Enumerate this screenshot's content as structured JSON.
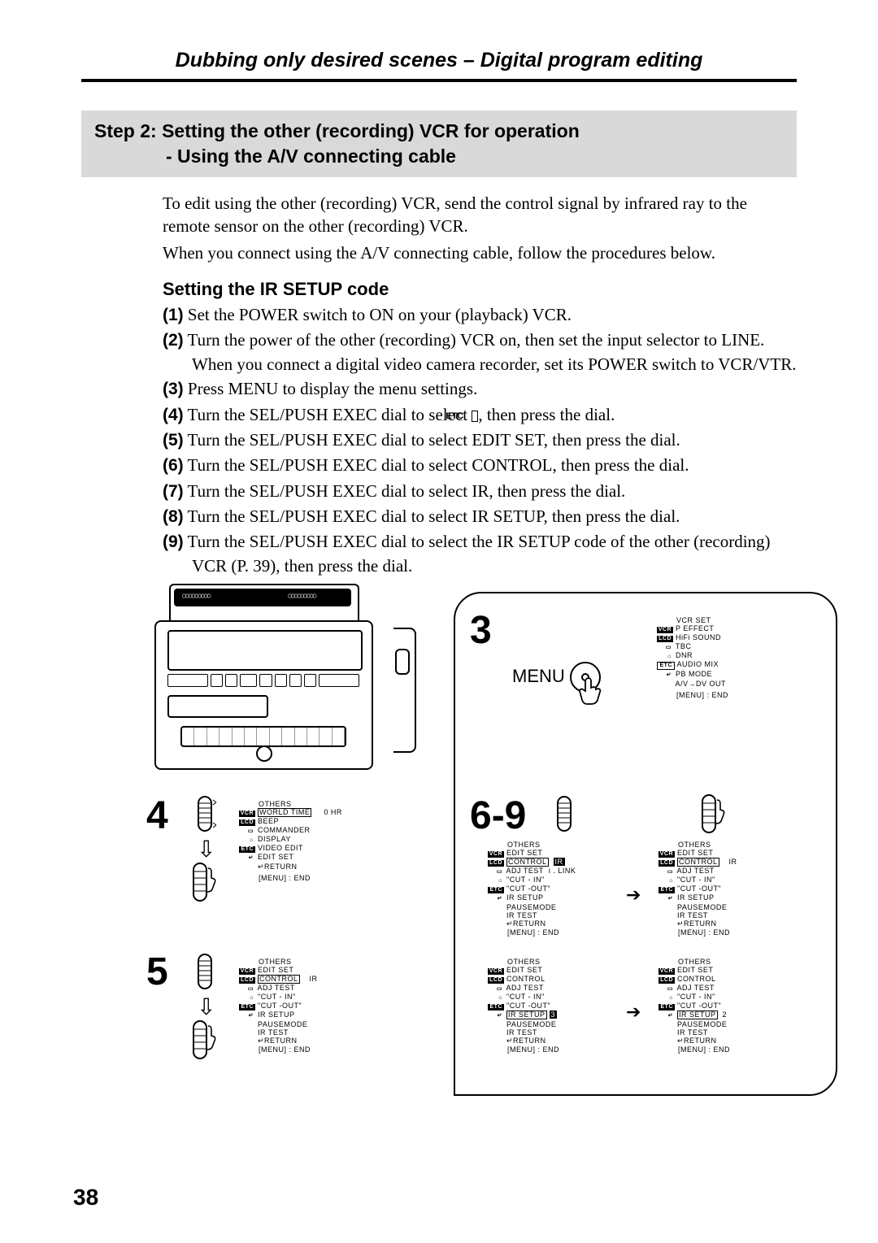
{
  "header": "Dubbing only desired scenes – Digital program editing",
  "step_box_l1": "Step 2: Setting the other (recording) VCR for operation",
  "step_box_l2": "- Using the A/V connecting cable",
  "intro_p1": "To edit using the other (recording) VCR, send the control signal by infrared ray to the remote sensor on the other (recording) VCR.",
  "intro_p2": "When you connect using the A/V connecting cable, follow the procedures below.",
  "sub_head": "Setting the IR SETUP code",
  "steps": {
    "n1": "(1)",
    "t1": "Set the POWER switch to ON on your (playback) VCR.",
    "n2": "(2)",
    "t2a": "Turn the power of the other (recording) VCR on, then set the input selector to LINE.",
    "t2b": "When you connect a digital video camera recorder, set its POWER switch to VCR/VTR.",
    "n3": "(3)",
    "t3": "Press MENU to display the menu settings.",
    "n4": "(4)",
    "t4a": "Turn the SEL/PUSH EXEC dial to select ",
    "t4b": ", then press the dial.",
    "n5": "(5)",
    "t5": "Turn the SEL/PUSH EXEC dial to select EDIT SET, then press the dial.",
    "n6": "(6)",
    "t6": "Turn the SEL/PUSH EXEC dial to select CONTROL, then press the dial.",
    "n7": "(7)",
    "t7": "Turn the SEL/PUSH EXEC dial to select IR, then press the dial.",
    "n8": "(8)",
    "t8": "Turn the SEL/PUSH EXEC dial to select IR SETUP, then press the dial.",
    "n9": "(9)",
    "t9": "Turn the SEL/PUSH EXEC dial to select the IR SETUP code of the other (recording) VCR (P. 39), then press the dial."
  },
  "etc_label": "ETC",
  "fig": {
    "n3": "3",
    "n4": "4",
    "n5": "5",
    "n69": "6-9",
    "menu_label": "MENU",
    "osd3": {
      "title": "VCR SET",
      "rows": [
        "P EFFECT",
        "HiFi SOUND",
        "TBC",
        "DNR",
        "AUDIO MIX",
        "PB MODE",
        "A/V→DV OUT"
      ],
      "foot": "[MENU] : END"
    },
    "osd4": {
      "title": "OTHERS",
      "rows": [
        "WORLD TIME",
        "BEEP",
        "COMMANDER",
        "DISPLAY",
        "VIDEO EDIT",
        "EDIT SET",
        "↵RETURN"
      ],
      "value": "0 HR",
      "foot": "[MENU] : END"
    },
    "osd5": {
      "title": "OTHERS",
      "rows": [
        "EDIT SET",
        "CONTROL",
        "ADJ TEST",
        "\"CUT - IN\"",
        "\"CUT -OUT\"",
        "IR SETUP",
        "PAUSEMODE",
        "IR TEST",
        "↵RETURN"
      ],
      "value": "IR",
      "foot": "[MENU] : END"
    },
    "osd6a": {
      "title": "OTHERS",
      "rows": [
        "EDIT SET",
        "CONTROL",
        "ADJ TEST",
        "\"CUT - IN\"",
        "\"CUT -OUT\"",
        "IR SETUP",
        "PAUSEMODE",
        "IR TEST",
        "↵RETURN"
      ],
      "value": "IR",
      "value2": "i . LINK",
      "foot": "[MENU] : END"
    },
    "osd6b": {
      "title": "OTHERS",
      "rows": [
        "EDIT SET",
        "CONTROL",
        "ADJ TEST",
        "\"CUT - IN\"",
        "\"CUT -OUT\"",
        "IR SETUP",
        "PAUSEMODE",
        "IR TEST",
        "↵RETURN"
      ],
      "value": "IR",
      "foot": "[MENU] : END"
    },
    "osd7a": {
      "title": "OTHERS",
      "rows": [
        "EDIT SET",
        "CONTROL",
        "ADJ TEST",
        "\"CUT - IN\"",
        "\"CUT -OUT\"",
        "IR SETUP",
        "PAUSEMODE",
        "IR TEST",
        "↵RETURN"
      ],
      "value": "3",
      "foot": "[MENU] : END"
    },
    "osd7b": {
      "title": "OTHERS",
      "rows": [
        "EDIT SET",
        "CONTROL",
        "ADJ TEST",
        "\"CUT - IN\"",
        "\"CUT -OUT\"",
        "IR SETUP",
        "PAUSEMODE",
        "IR TEST",
        "↵RETURN"
      ],
      "value": "2",
      "foot": "[MENU] : END"
    },
    "icon_labels": [
      "VCR",
      "LCD",
      "",
      "",
      "ETC",
      ""
    ]
  },
  "page_num": "38"
}
